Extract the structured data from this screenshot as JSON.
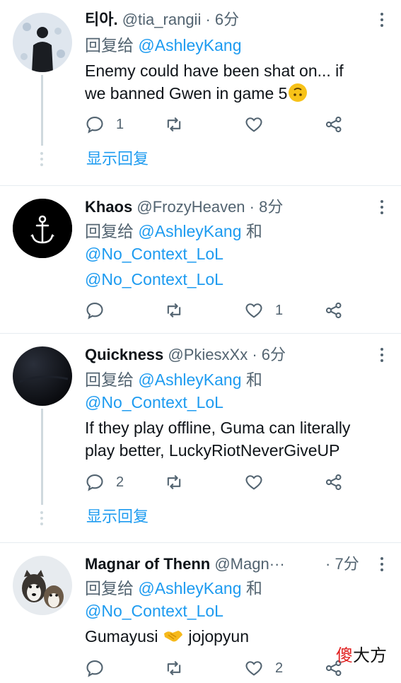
{
  "tweets": [
    {
      "name": "티아.",
      "handle": "@tia_rangii",
      "sep": "·",
      "time": "6分",
      "reply_prefix": "回复给",
      "reply_to": [
        "@AshleyKang"
      ],
      "text_lines": [
        "Enemy could have been shat on... if",
        "we banned Gwen in game 5"
      ],
      "reply_count": "1",
      "retweet_count": "",
      "like_count": "",
      "show_replies": "显示回复"
    },
    {
      "name": "Khaos",
      "handle": "@FrozyHeaven",
      "sep": "·",
      "time": "8分",
      "reply_prefix": "回复给",
      "reply_to": [
        "@AshleyKang",
        "@No_Context_LoL"
      ],
      "and_word": "和",
      "text_lines": [
        "@No_Context_LoL"
      ],
      "reply_count": "",
      "retweet_count": "",
      "like_count": "1"
    },
    {
      "name": "Quickness",
      "handle": "@PkiesxXx",
      "sep": "·",
      "time": "6分",
      "reply_prefix": "回复给",
      "reply_to": [
        "@AshleyKang",
        "@No_Context_LoL"
      ],
      "and_word": "和",
      "text_lines": [
        "If they play offline, Guma can literally",
        "play better, LuckyRiotNeverGiveUP"
      ],
      "reply_count": "2",
      "retweet_count": "",
      "like_count": "",
      "show_replies": "显示回复"
    },
    {
      "name": "Magnar of Thenn",
      "handle": "@Magn···",
      "sep": "·",
      "time": "7分",
      "reply_prefix": "回复给",
      "reply_to": [
        "@AshleyKang",
        "@No_Context_LoL"
      ],
      "and_word": "和",
      "text_before": "Gumayusi",
      "text_after": "jojopyun",
      "reply_count": "",
      "retweet_count": "",
      "like_count": "2"
    }
  ],
  "watermark": {
    "red": "傻",
    "dark": "大方"
  },
  "colors": {
    "link": "#1d9bf0",
    "muted": "#536471",
    "divider": "#e6ecf0",
    "thread": "#cfd9de"
  },
  "icons": {
    "reply": "reply-icon",
    "retweet": "retweet-icon",
    "like": "heart-icon",
    "share": "share-icon",
    "more": "more-icon"
  }
}
